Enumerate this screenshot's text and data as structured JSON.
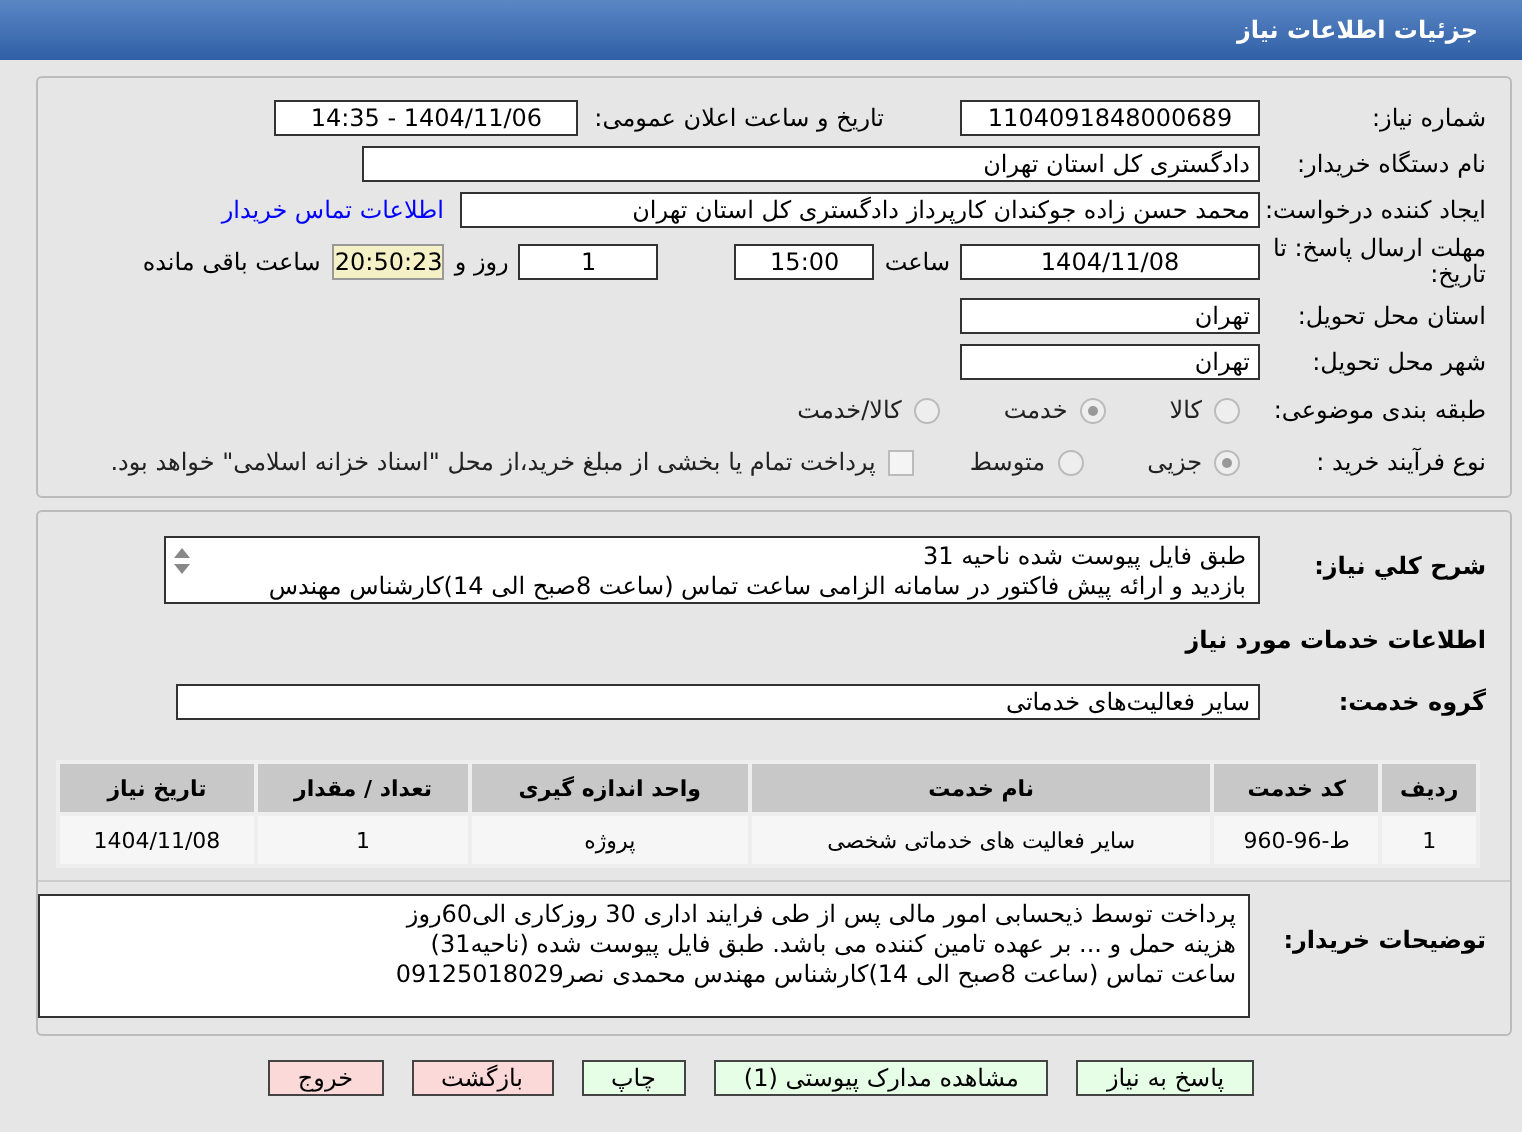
{
  "header": {
    "title": "جزئیات اطلاعات نیاز"
  },
  "need_number": {
    "label": "شماره نیاز:",
    "value": "1104091848000689"
  },
  "announce": {
    "label": "تاریخ و ساعت اعلان عمومی:",
    "value": "1404/11/06 - 14:35"
  },
  "buyer": {
    "label": "نام دستگاه خریدار:",
    "value": "دادگستری کل استان تهران"
  },
  "requester": {
    "label": "ایجاد کننده درخواست:",
    "value": "محمد حسن زاده جوکندان کارپرداز دادگستری کل استان تهران",
    "link": "اطلاعات تماس خریدار"
  },
  "deadline": {
    "label": "مهلت ارسال پاسخ: تا تاریخ:",
    "date": "1404/11/08",
    "time_label": "ساعت",
    "time": "15:00",
    "days": "1",
    "days_label": "روز و",
    "remaining": "20:50:23",
    "remaining_label": "ساعت باقی مانده"
  },
  "province": {
    "label": "استان محل تحویل:",
    "value": "تهران"
  },
  "city": {
    "label": "شهر محل تحویل:",
    "value": "تهران"
  },
  "category": {
    "label": "طبقه بندی موضوعی:",
    "options": [
      {
        "label": "کالا",
        "selected": false
      },
      {
        "label": "خدمت",
        "selected": true
      },
      {
        "label": "کالا/خدمت",
        "selected": false
      }
    ]
  },
  "process": {
    "label": "نوع فرآیند خرید :",
    "options": [
      {
        "label": "جزیی",
        "selected": true
      },
      {
        "label": "متوسط",
        "selected": false
      }
    ],
    "checkbox": {
      "checked": false,
      "label": "پرداخت تمام یا بخشی از مبلغ خرید،از محل \"اسناد خزانه اسلامی\" خواهد بود."
    }
  },
  "description": {
    "label": "شرح کلي نياز:",
    "lines": [
      "طبق فایل پیوست شده ناحیه 31",
      "بازدید و ارائه پیش  فاکتور در سامانه الزامی ساعت تماس (ساعت 8صبح الی 14)کارشناس مهندس"
    ]
  },
  "services_title": "اطلاعات خدمات مورد نیاز",
  "service_group": {
    "label": "گروه خدمت:",
    "value": "سایر فعالیت‌های خدماتی"
  },
  "table": {
    "columns": [
      "ردیف",
      "کد خدمت",
      "نام خدمت",
      "واحد اندازه گیری",
      "تعداد / مقدار",
      "تاریخ نیاز"
    ],
    "rows": [
      [
        "1",
        "ط-96-960",
        "سایر فعالیت های خدماتی شخصی",
        "پروژه",
        "1",
        "1404/11/08"
      ]
    ]
  },
  "buyer_notes": {
    "label": "توضیحات خریدار:",
    "lines": [
      "پرداخت توسط ذیحسابی امور مالی پس از طی فرایند اداری 30 روزکاری الی60روز",
      "هزینه حمل و ... بر عهده تامین کننده می باشد. طبق فایل پیوست شده (ناحیه31)",
      "ساعت تماس (ساعت 8صبح الی 14)کارشناس مهندس محمدی نصر09125018029"
    ]
  },
  "buttons": [
    {
      "label": "پاسخ به نیاز",
      "kind": "green"
    },
    {
      "label": "مشاهده مدارک پیوستی (1)",
      "kind": "green"
    },
    {
      "label": "چاپ",
      "kind": "green"
    },
    {
      "label": "بازگشت",
      "kind": "red"
    },
    {
      "label": "خروج",
      "kind": "red"
    }
  ]
}
